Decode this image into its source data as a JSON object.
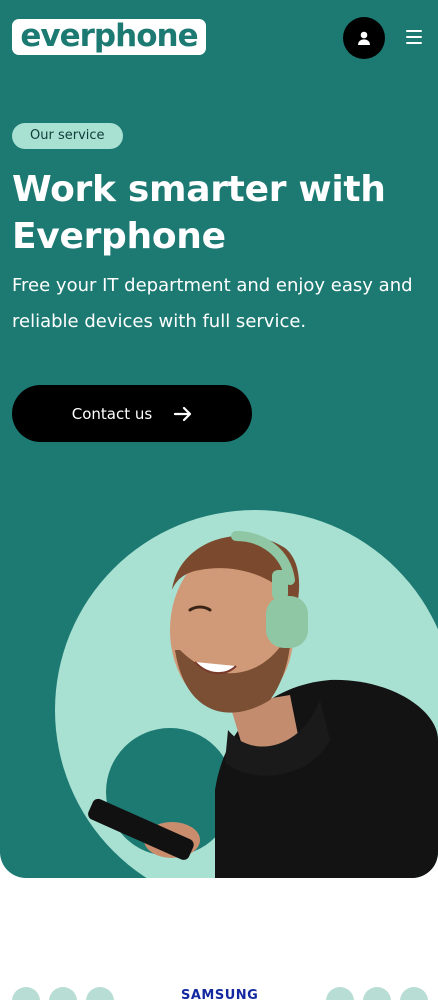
{
  "header": {
    "logo_text": "everphone",
    "account_icon": "user-icon",
    "menu_icon": "hamburger-menu-icon"
  },
  "hero": {
    "tag": "Our service",
    "headline_line1": "Work smarter with",
    "headline_line2": "Everphone",
    "subtext_line1": "Free your IT department and enjoy easy and",
    "subtext_line2": "reliable devices with full service.",
    "cta_label": "Contact us",
    "cta_icon": "arrow-right-icon",
    "image": "man-with-headphones-holding-phone"
  },
  "partners": {
    "logo_text": "SAMSUNG"
  },
  "colors": {
    "brand_teal": "#1d7a73",
    "mint": "#a8e0d2",
    "black": "#000000",
    "white": "#ffffff"
  }
}
